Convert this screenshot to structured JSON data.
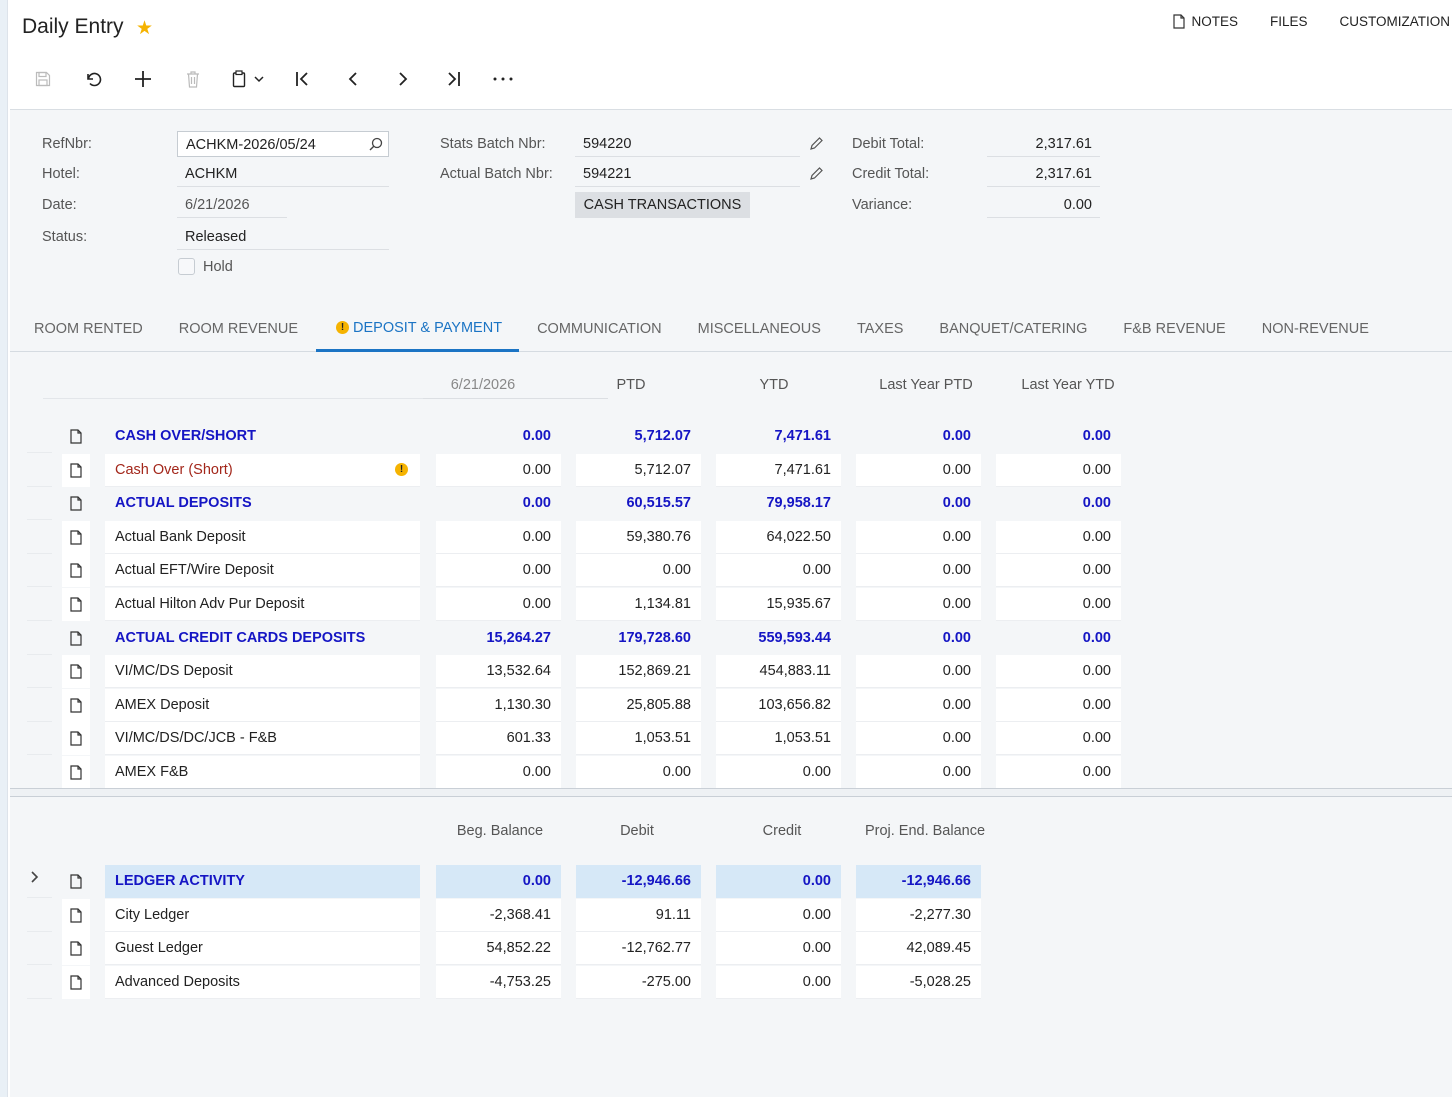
{
  "header": {
    "title": "Daily Entry",
    "links": {
      "notes": "NOTES",
      "files": "FILES",
      "customization": "CUSTOMIZATION"
    }
  },
  "toolbar": {
    "icons": [
      "save-icon",
      "undo-icon",
      "add-icon",
      "delete-icon",
      "copy-paste-icon",
      "first-icon",
      "previous-icon",
      "next-icon",
      "last-icon",
      "more-icon"
    ]
  },
  "form": {
    "refnbr_label": "RefNbr:",
    "refnbr_value": "ACHKM-2026/05/24",
    "hotel_label": "Hotel:",
    "hotel_value": "ACHKM",
    "date_label": "Date:",
    "date_value": "6/21/2026",
    "status_label": "Status:",
    "status_value": "Released",
    "hold_label": "Hold",
    "stats_batch_label": "Stats Batch Nbr:",
    "stats_batch_value": "594220",
    "actual_batch_label": "Actual Batch Nbr:",
    "actual_batch_value": "594221",
    "cash_transactions_label": "CASH TRANSACTIONS",
    "debit_total_label": "Debit Total:",
    "debit_total_value": "2,317.61",
    "credit_total_label": "Credit Total:",
    "credit_total_value": "2,317.61",
    "variance_label": "Variance:",
    "variance_value": "0.00"
  },
  "tabs": [
    {
      "label": "ROOM RENTED"
    },
    {
      "label": "ROOM REVENUE"
    },
    {
      "label": "DEPOSIT & PAYMENT",
      "active": true
    },
    {
      "label": "COMMUNICATION"
    },
    {
      "label": "MISCELLANEOUS"
    },
    {
      "label": "TAXES"
    },
    {
      "label": "BANQUET/CATERING"
    },
    {
      "label": "F&B REVENUE"
    },
    {
      "label": "NON-REVENUE"
    }
  ],
  "grid1": {
    "headers": [
      "6/21/2026",
      "PTD",
      "YTD",
      "Last Year PTD",
      "Last Year YTD"
    ],
    "rows": [
      {
        "name": "CASH OVER/SHORT",
        "group": true,
        "values": [
          "0.00",
          "5,712.07",
          "7,471.61",
          "0.00",
          "0.00"
        ]
      },
      {
        "name": "Cash Over (Short)",
        "red": true,
        "warning": true,
        "values": [
          "0.00",
          "5,712.07",
          "7,471.61",
          "0.00",
          "0.00"
        ]
      },
      {
        "name": "ACTUAL DEPOSITS",
        "group": true,
        "values": [
          "0.00",
          "60,515.57",
          "79,958.17",
          "0.00",
          "0.00"
        ]
      },
      {
        "name": "Actual Bank Deposit",
        "values": [
          "0.00",
          "59,380.76",
          "64,022.50",
          "0.00",
          "0.00"
        ]
      },
      {
        "name": "Actual EFT/Wire Deposit",
        "values": [
          "0.00",
          "0.00",
          "0.00",
          "0.00",
          "0.00"
        ]
      },
      {
        "name": "Actual Hilton Adv Pur Deposit",
        "values": [
          "0.00",
          "1,134.81",
          "15,935.67",
          "0.00",
          "0.00"
        ]
      },
      {
        "name": "ACTUAL CREDIT CARDS DEPOSITS",
        "group": true,
        "values": [
          "15,264.27",
          "179,728.60",
          "559,593.44",
          "0.00",
          "0.00"
        ]
      },
      {
        "name": "VI/MC/DS Deposit",
        "values": [
          "13,532.64",
          "152,869.21",
          "454,883.11",
          "0.00",
          "0.00"
        ]
      },
      {
        "name": "AMEX Deposit",
        "values": [
          "1,130.30",
          "25,805.88",
          "103,656.82",
          "0.00",
          "0.00"
        ]
      },
      {
        "name": "VI/MC/DS/DC/JCB - F&B",
        "values": [
          "601.33",
          "1,053.51",
          "1,053.51",
          "0.00",
          "0.00"
        ]
      },
      {
        "name": "AMEX F&B",
        "values": [
          "0.00",
          "0.00",
          "0.00",
          "0.00",
          "0.00"
        ]
      }
    ]
  },
  "grid2": {
    "headers": [
      "Beg. Balance",
      "Debit",
      "Credit",
      "Proj. End. Balance"
    ],
    "rows": [
      {
        "name": "LEDGER ACTIVITY",
        "group": true,
        "selected": true,
        "values": [
          "0.00",
          "-12,946.66",
          "0.00",
          "-12,946.66"
        ]
      },
      {
        "name": "City Ledger",
        "values": [
          "-2,368.41",
          "91.11",
          "0.00",
          "-2,277.30"
        ]
      },
      {
        "name": "Guest Ledger",
        "values": [
          "54,852.22",
          "-12,762.77",
          "0.00",
          "42,089.45"
        ]
      },
      {
        "name": "Advanced Deposits",
        "values": [
          "-4,753.25",
          "-275.00",
          "0.00",
          "-5,028.25"
        ]
      }
    ]
  },
  "colors": {
    "accent": "#1b74c4",
    "group_text": "#1515c4",
    "warning": "#f5b301",
    "error_text": "#a3271b"
  }
}
